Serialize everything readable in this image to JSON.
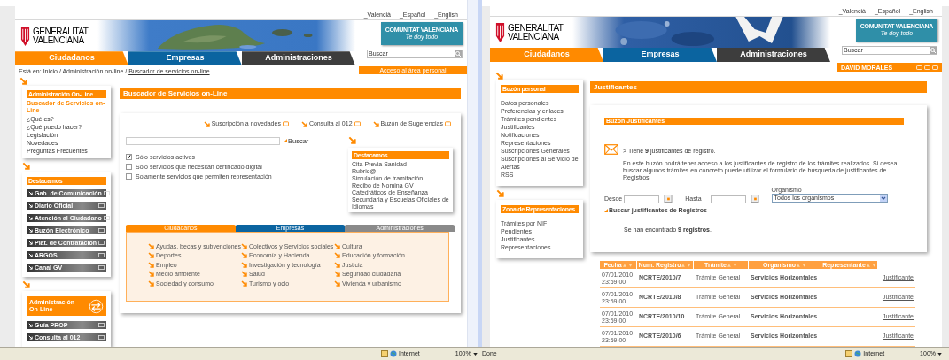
{
  "left_window": {
    "language_links": [
      "_Valencià",
      "_Español",
      "_English"
    ],
    "logo": {
      "line1": "GENERALITAT",
      "line2": "VALENCIANA"
    },
    "brand_badge": {
      "name": "COMUNITAT VALENCIANA",
      "slogan": "Te doy todo"
    },
    "nav_tabs": [
      {
        "label": "Ciudadanos",
        "color": "#ff8a00"
      },
      {
        "label": "Empresas",
        "color": "#0b64a0"
      },
      {
        "label": "Administraciones",
        "color": "#3d3d3d"
      }
    ],
    "search": {
      "placeholder": "Buscar"
    },
    "personal_link": "Acceso al área personal",
    "breadcrumb": {
      "prefix": "Está en: Inicio / Administración on-line / ",
      "current": "Buscador de servicios on-line"
    },
    "sidebar": {
      "menu": {
        "title": "Administración On-Line",
        "items": [
          {
            "label": "Buscador de Servicios on-Line",
            "selected": true
          },
          {
            "label": "¿Qué es?",
            "selected": false
          },
          {
            "label": "¿Qué puedo hacer?",
            "selected": false
          },
          {
            "label": "Legislación",
            "selected": false
          },
          {
            "label": "Novedades",
            "selected": false
          },
          {
            "label": "Preguntas Frecuentes",
            "selected": false
          }
        ]
      },
      "featured": {
        "title": "Destacamos",
        "items": [
          "Gab. de Comunicación",
          "Diario Oficial",
          "Atención al Ciudadano",
          "Buzón Electrónico",
          "Plat. de Contratación",
          "ARGOS",
          "Canal GV"
        ]
      },
      "promo": {
        "title": "Administración On-Line",
        "items": [
          "Guía PROP",
          "Consulta al 012"
        ]
      }
    },
    "main": {
      "title": "Buscador de Servicios on-Line",
      "quick_links": [
        "Suscripción a novedades",
        "Consulta al 012",
        "Buzón de Sugerencias"
      ],
      "search_button": "Buscar",
      "filters": [
        {
          "label": "Sólo servicios activos",
          "checked": true
        },
        {
          "label": "Sólo servicios que necesitan certificado digital",
          "checked": false
        },
        {
          "label": "Solamente servicios que permiten representación",
          "checked": false
        }
      ],
      "featured": {
        "title": "Destacamos",
        "items": [
          "Cita Previa Sanidad",
          "Rubric@",
          "Simulación de tramitación",
          "Recibo de Nomina GV",
          "Catedráticos de Enseñanza Secundaria y Escuelas Oficiales de Idiomas"
        ]
      },
      "category_tabs": [
        {
          "label": "Ciudadanos",
          "color": "#ff8a00"
        },
        {
          "label": "Empresas",
          "color": "#0b64a0"
        },
        {
          "label": "Administraciones",
          "color": "#8a8a8a"
        }
      ],
      "categories": [
        [
          "Ayudas, becas y subvenciones",
          "Deportes",
          "Empleo",
          "Medio ambiente",
          "Sociedad y consumo"
        ],
        [
          "Colectivos y Servicios sociales",
          "Economía y Hacienda",
          "Investigación y tecnología",
          "Salud",
          "Turismo y ocio"
        ],
        [
          "Cultura",
          "Educación y formación",
          "Justicia",
          "Seguridad ciudadana",
          "Vivienda y urbanismo"
        ]
      ]
    }
  },
  "right_window": {
    "language_links": [
      "_Valencià",
      "_Español",
      "_English"
    ],
    "logo": {
      "line1": "GENERALITAT",
      "line2": "VALENCIANA"
    },
    "brand_badge": {
      "name": "COMUNITAT VALENCIANA",
      "slogan": "Te doy todo"
    },
    "nav_tabs": [
      {
        "label": "Ciudadanos",
        "color": "#ff8a00"
      },
      {
        "label": "Empresas",
        "color": "#0b64a0"
      },
      {
        "label": "Administraciones",
        "color": "#3d3d3d"
      }
    ],
    "search": {
      "placeholder": "Buscar"
    },
    "user_name": "DAVID MORALES",
    "sidebar": [
      {
        "title": "Buzón personal",
        "items": [
          "Datos personales",
          "Preferencias y enlaces",
          "Trámites pendientes",
          "Justificantes",
          "Notificaciones",
          "Representaciones",
          "Suscripciones Generales",
          "Suscripciones al Servicio de Alertas",
          "RSS"
        ]
      },
      {
        "title": "Zona de Representaciones",
        "items": [
          "Trámites por NIF",
          "Pendientes",
          "Justificantes",
          "Representaciones"
        ]
      }
    ],
    "main": {
      "title": "Justificantes",
      "section_title": "Buzón Justificantes",
      "notice": "> Tiene **9** justificantes de registro.",
      "description": "En este buzón podrá tener acceso a los justificantes de registro de los trámites realizados. Si desea buscar algunos trámites en concreto puede utilizar el formulario de búsqueda de justificantes de Registros.",
      "from_label": "Desde",
      "to_label": "Hasta",
      "agency_label": "Organismo",
      "agency_value": "Todos los organismos",
      "search_button": "Buscar justificantes de Registros",
      "result": "Se han encontrado **9 registros**.",
      "table": {
        "columns": [
          "Fecha",
          "Num. Registro",
          "Trámite",
          "Organismo",
          "Representante"
        ],
        "rows": [
          {
            "date": "07/01/2010",
            "time": "23:59:00",
            "number": "NCRTE/2010/7",
            "procedure": "Trámite General",
            "agency": "Servicios Horizontales",
            "link": "Justificante"
          },
          {
            "date": "07/01/2010",
            "time": "23:59:00",
            "number": "NCRTE/2010/8",
            "procedure": "Trámite General",
            "agency": "Servicios Horizontales",
            "link": "Justificante"
          },
          {
            "date": "07/01/2010",
            "time": "23:59:00",
            "number": "NCRTE/2010/10",
            "procedure": "Trámite General",
            "agency": "Servicios Horizontales",
            "link": "Justificante"
          },
          {
            "date": "07/01/2010",
            "time": "23:59:00",
            "number": "NCRTE/2010/6",
            "procedure": "Trámite General",
            "agency": "Servicios Horizontales",
            "link": "Justificante"
          }
        ]
      }
    }
  },
  "status_bars": [
    {
      "zone": "Internet",
      "zoom": "100%"
    },
    {
      "status": "Done",
      "zone": "Internet",
      "zoom": "100%"
    }
  ]
}
